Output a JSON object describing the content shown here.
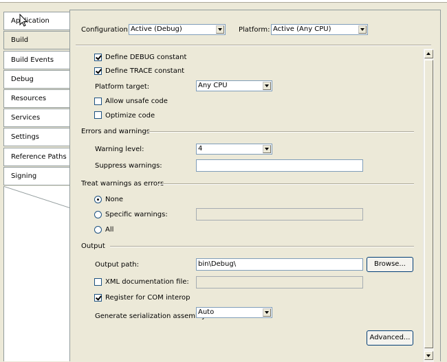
{
  "tabs": [
    {
      "label": "Application"
    },
    {
      "label": "Build"
    },
    {
      "label": "Build Events"
    },
    {
      "label": "Debug"
    },
    {
      "label": "Resources"
    },
    {
      "label": "Services"
    },
    {
      "label": "Settings"
    },
    {
      "label": "Reference Paths"
    },
    {
      "label": "Signing"
    }
  ],
  "header": {
    "configuration_label": "Configuration:",
    "configuration_value": "Active (Debug)",
    "platform_label": "Platform:",
    "platform_value": "Active (Any CPU)"
  },
  "general": {
    "define_debug": "Define DEBUG constant",
    "define_debug_checked": true,
    "define_trace": "Define TRACE constant",
    "define_trace_checked": true,
    "platform_target_label": "Platform target:",
    "platform_target_value": "Any CPU",
    "allow_unsafe": "Allow unsafe code",
    "allow_unsafe_checked": false,
    "optimize": "Optimize code",
    "optimize_checked": false
  },
  "errors": {
    "group_label": "Errors and warnings",
    "warning_level_label": "Warning level:",
    "warning_level_value": "4",
    "suppress_label": "Suppress warnings:",
    "suppress_value": ""
  },
  "treat": {
    "group_label": "Treat warnings as errors",
    "none": "None",
    "specific": "Specific warnings:",
    "all": "All",
    "selected": "none"
  },
  "output": {
    "group_label": "Output",
    "path_label": "Output path:",
    "path_value": "bin\\Debug\\",
    "browse": "Browse...",
    "xml_doc": "XML documentation file:",
    "xml_doc_checked": false,
    "register_com": "Register for COM interop",
    "register_com_checked": true,
    "serialization_label": "Generate serialization assembly:",
    "serialization_value": "Auto",
    "advanced": "Advanced..."
  },
  "colors": {
    "background": "#ece9d8",
    "border": "#919b9c",
    "input_border": "#7f9db9"
  }
}
